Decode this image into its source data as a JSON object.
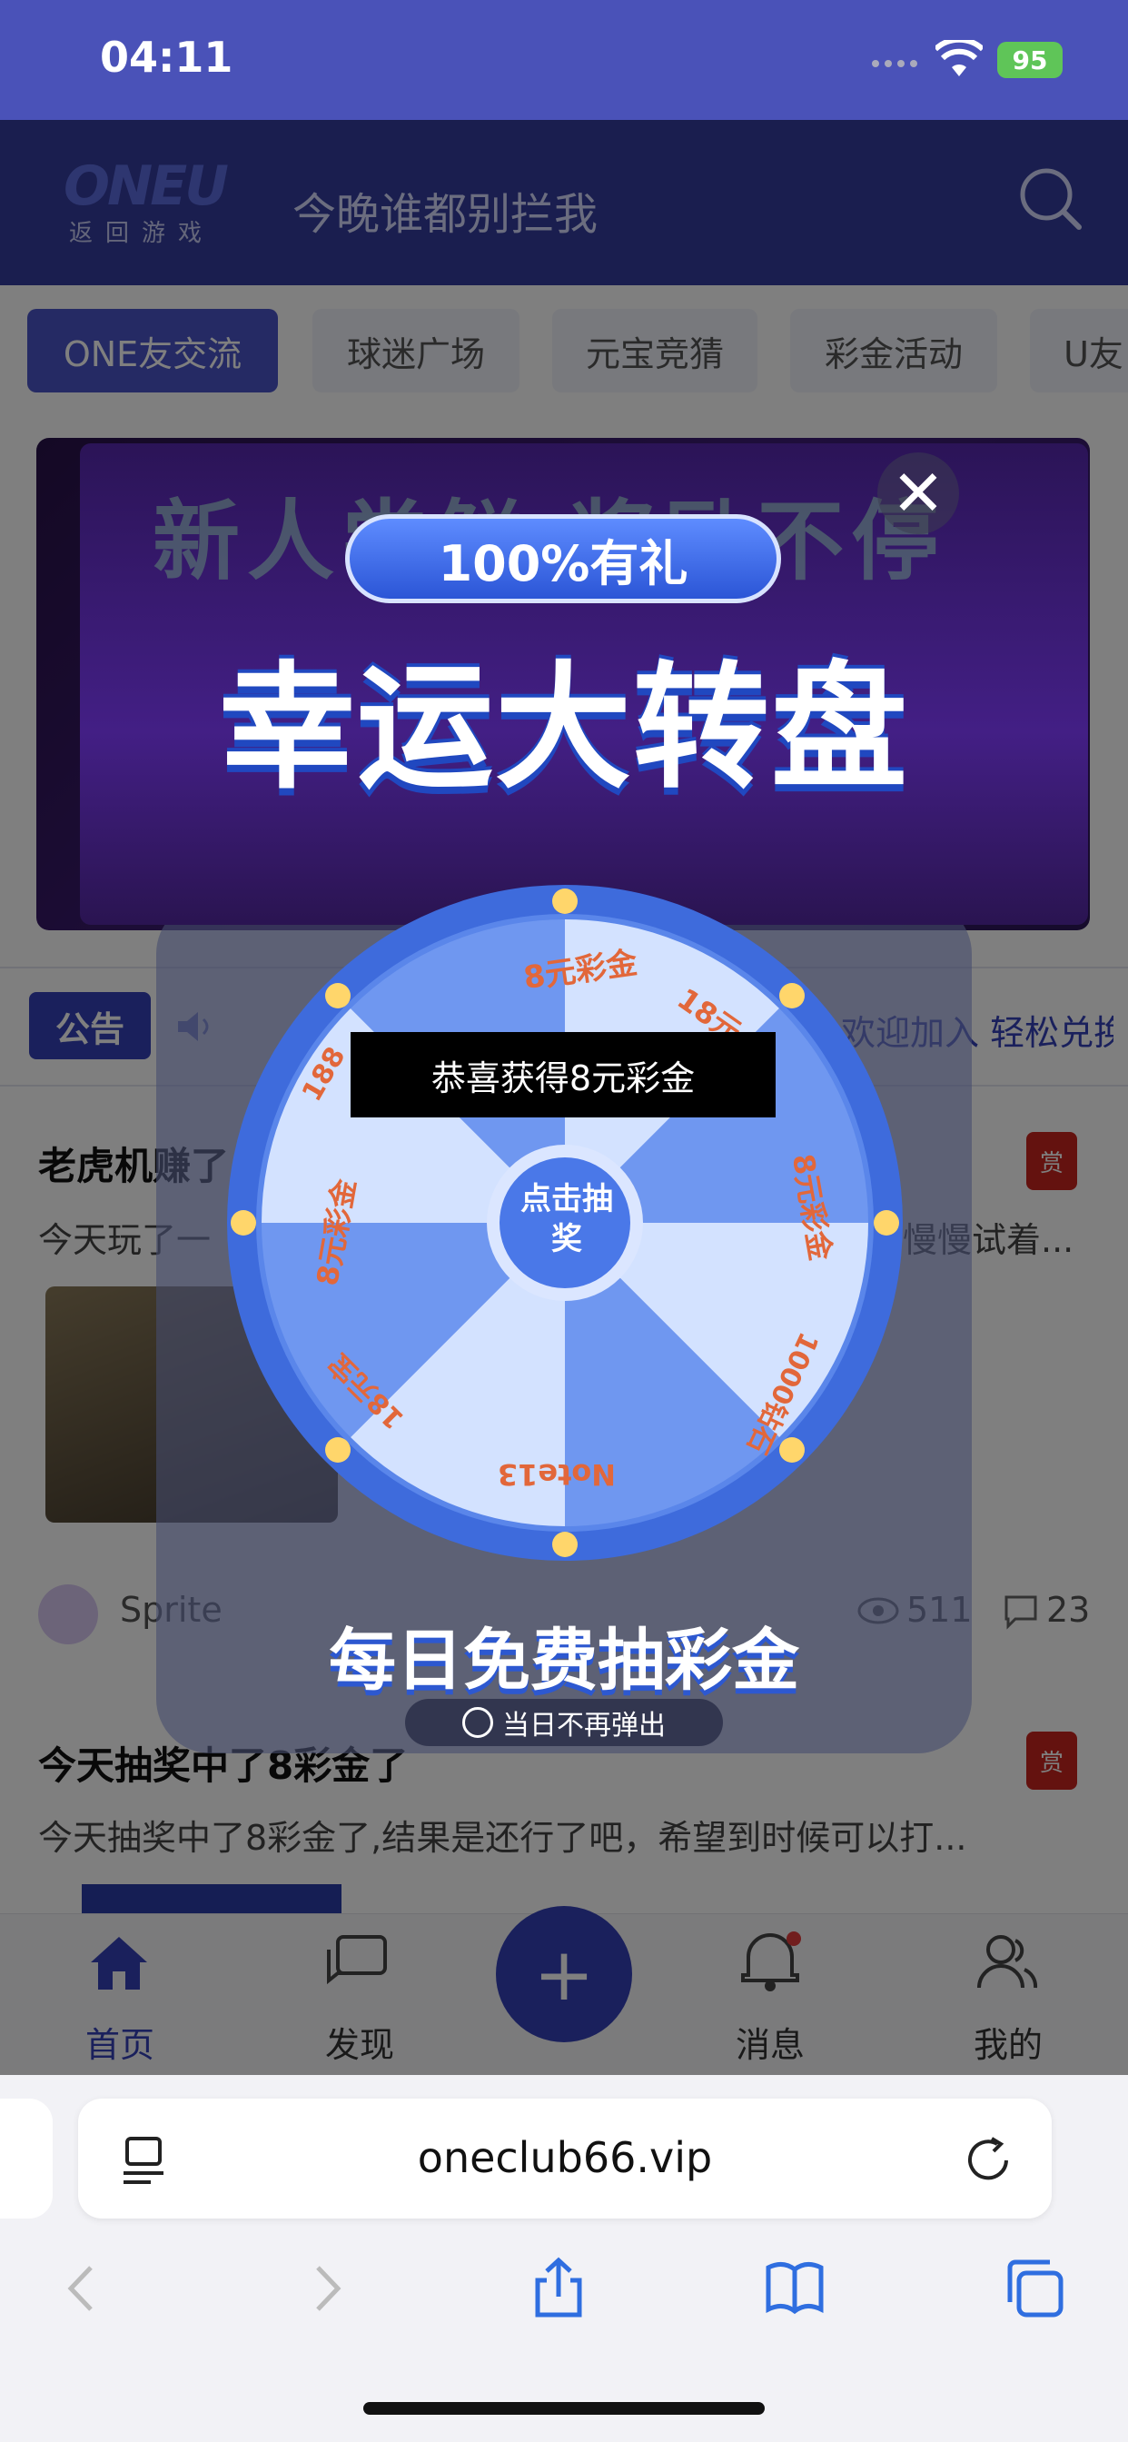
{
  "status_bar": {
    "time": "04:11",
    "battery": "95"
  },
  "header": {
    "logo": "ONEU",
    "logo_sub": "返回游戏",
    "title": "今晚谁都别拦我"
  },
  "tabs": [
    "ONE友交流",
    "球迷广场",
    "元宝竞猜",
    "彩金活动",
    "U友"
  ],
  "notice": {
    "badge": "公告",
    "text": "欢迎加入 轻松兑换"
  },
  "posts": [
    {
      "title": "老虎机赚了",
      "excerpt": "今天玩了一",
      "excerpt_tail": "慢慢试着...",
      "author": "Sprite",
      "views": "511",
      "comments": "23"
    },
    {
      "title": "今天抽奖中了8彩金了",
      "excerpt": "今天抽奖中了8彩金了,结果是还行了吧，希望到时候可以打..."
    }
  ],
  "reward_label": "赏",
  "bottom_nav": {
    "home": "首页",
    "discover": "发现",
    "messages": "消息",
    "mine": "我的",
    "fab": "+"
  },
  "popup": {
    "banner_bg_text": "新人尝鲜 奖励不停",
    "pill": "100%有礼",
    "title": "幸运大转盘",
    "wheel_center": "点击抽奖",
    "wheel_segments": [
      "8元彩金",
      "18元",
      "8元彩金",
      "1000钻石",
      "Note13",
      "18元宝",
      "8元彩金",
      "188"
    ],
    "toast": "恭喜获得8元彩金",
    "daily": "每日免费抽彩金",
    "dont_show": "当日不再弹出"
  },
  "safari": {
    "url": "oneclub66.vip"
  },
  "colors": {
    "primary": "#3441b8",
    "accent": "#5c6ce0",
    "wheel_blue": "#4a78e8",
    "wheel_light": "#cfe0ff",
    "segment_text": "#e2673a"
  }
}
